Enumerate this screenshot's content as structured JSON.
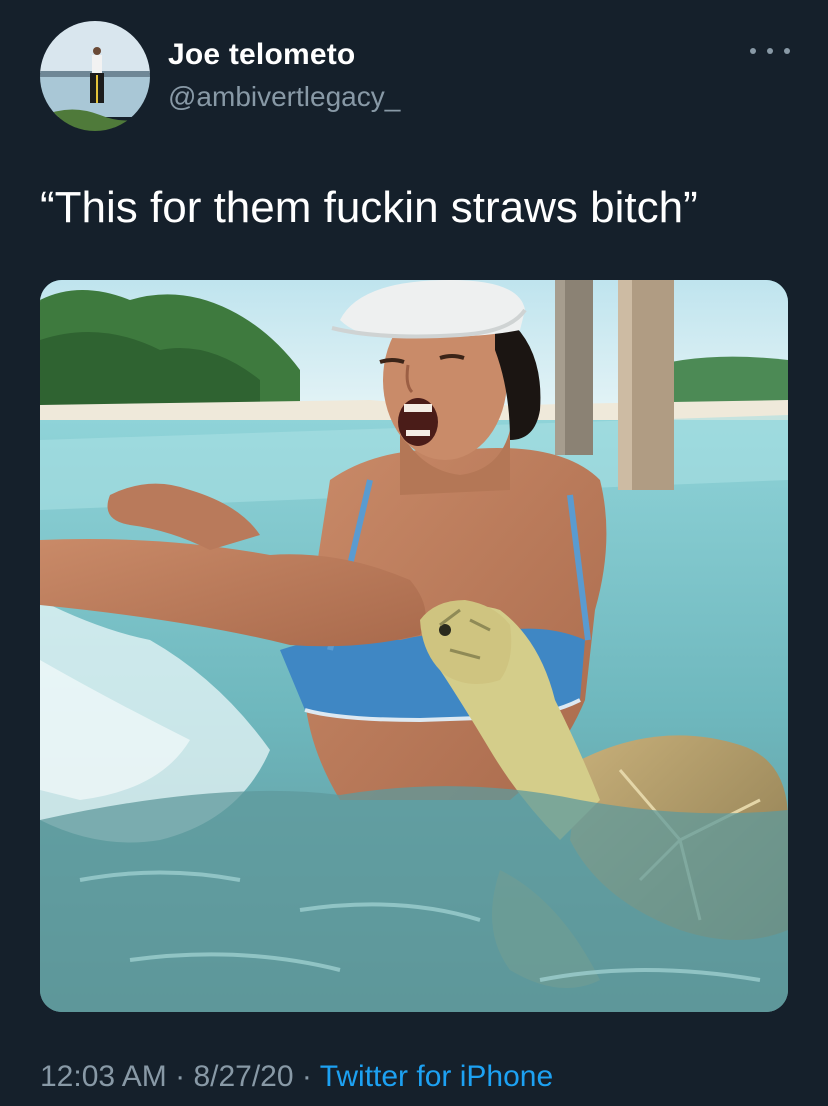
{
  "tweet": {
    "author": {
      "display_name": "Joe telometo",
      "handle": "@ambivertlegacy_"
    },
    "text": "“This for them fuckin straws bitch”",
    "timestamp": {
      "time": "12:03 AM",
      "separator": "·",
      "date": "8/27/20",
      "source": "Twitter for iPhone"
    },
    "more_icon": "more-horizontal-icon"
  },
  "colors": {
    "background": "#15202b",
    "primary_text": "#ffffff",
    "secondary_text": "#8899a6",
    "link": "#1da1f2"
  }
}
